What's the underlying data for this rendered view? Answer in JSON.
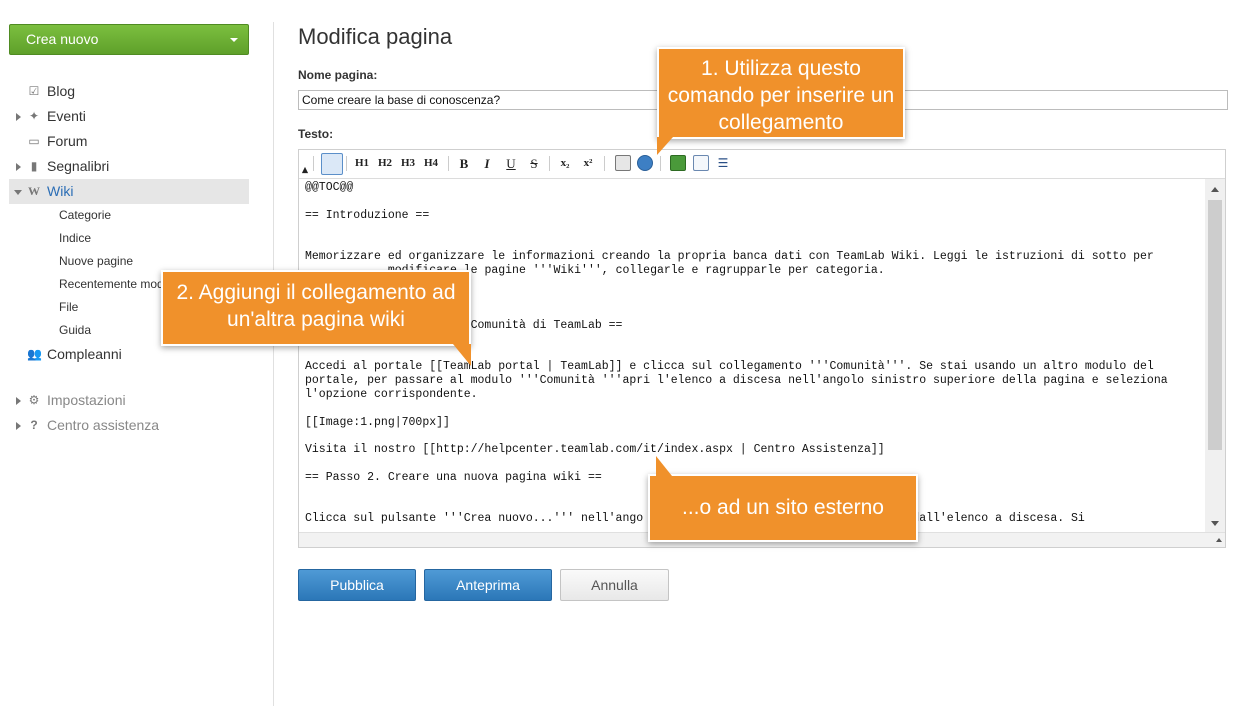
{
  "sidebar": {
    "create_label": "Crea nuovo",
    "items": [
      {
        "label": "Blog",
        "icon": "edit-icon"
      },
      {
        "label": "Eventi",
        "icon": "pin-icon"
      },
      {
        "label": "Forum",
        "icon": "speech-bubble-icon"
      },
      {
        "label": "Segnalibri",
        "icon": "bookmark-icon"
      },
      {
        "label": "Wiki",
        "icon": "wiki-w-icon"
      },
      {
        "label": "Compleanni",
        "icon": "people-icon"
      },
      {
        "label": "Impostazioni",
        "icon": "gear-icon"
      },
      {
        "label": "Centro assistenza",
        "icon": "question-icon"
      }
    ],
    "wiki_sub": [
      "Categorie",
      "Indice",
      "Nuove pagine",
      "Recentemente modificate",
      "File",
      "Guida"
    ]
  },
  "main": {
    "title": "Modifica pagina",
    "name_label": "Nome pagina:",
    "name_value": "Come creare la base di conoscenza?",
    "text_label": "Testo:",
    "toolbar": {
      "h1": "H1",
      "h2": "H2",
      "h3": "H3",
      "h4": "H4",
      "bold": "B",
      "italic": "I",
      "underline": "U",
      "strike": "S",
      "sub": "x₂",
      "sup": "x²"
    },
    "editor_lines": [
      "@@TOC@@",
      "",
      "== Introduzione ==",
      "",
      "",
      "Memorizzare ed organizzare le informazioni creando la propria banca dati con TeamLab Wiki. Leggi le istruzioni di sotto per",
      "            modificare le pagine '''Wiki''', collegarle e ragrupparle per categoria.",
      "",
      "",
      "",
      "                      a Comunità di TeamLab ==",
      "",
      "",
      "Accedi al portale [[TeamLab portal | TeamLab]] e clicca sul collegamento '''Comunità'''. Se stai usando un altro modulo del",
      "portale, per passare al modulo '''Comunità '''apri l'elenco a discesa nell'angolo sinistro superiore della pagina e seleziona",
      "l'opzione corrispondente.",
      "",
      "[[Image:1.png|700px]]",
      "",
      "Visita il nostro [[http://helpcenter.teamlab.com/it/index.aspx | Centro Assistenza]]",
      "",
      "== Passo 2. Creare una nuova pagina wiki ==",
      "",
      "",
      "Clicca sul pulsante '''Crea nuovo...''' nell'ango                          zione Pagina dall'elenco a discesa. Si"
    ],
    "buttons": {
      "publish": "Pubblica",
      "preview": "Anteprima",
      "cancel": "Annulla"
    }
  },
  "callouts": {
    "c1": "1. Utilizza questo comando per inserire un collegamento",
    "c2": "2. Aggiungi il collegamento ad un'altra pagina wiki",
    "c3": "...o ad un sito esterno"
  },
  "colors": {
    "accent_orange": "#f0912b",
    "create_green": "#6aae33",
    "primary_blue": "#3a86c8",
    "link_blue": "#2a6db5"
  }
}
